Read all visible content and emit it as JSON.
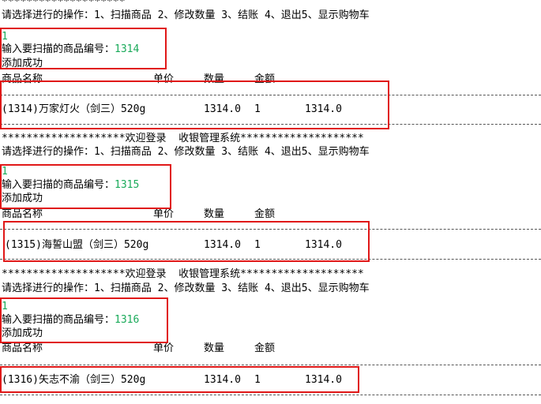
{
  "banner_full": "********************欢迎登录  收银管理系统********************",
  "banner_top": "********************",
  "menu": "请选择进行的操作：1、扫描商品 2、修改数量 3、结账 4、退出5、显示购物车",
  "input_choice": "1",
  "prompt": "输入要扫描的商品编号：",
  "success": "添加成功",
  "table_header": {
    "name": "商品名称",
    "price": "单价",
    "qty": "数量",
    "amount": "金额"
  },
  "blocks": [
    {
      "code": "1314",
      "row": {
        "name": "(1314)万家灯火（剑三）520g",
        "price": "1314.0",
        "qty": "1",
        "amount": "1314.0"
      }
    },
    {
      "code": "1315",
      "row": {
        "name": "(1315)海誓山盟（剑三）520g",
        "price": "1314.0",
        "qty": "1",
        "amount": "1314.0"
      }
    },
    {
      "code": "1316",
      "row": {
        "name": "(1316)矢志不渝（剑三）520g",
        "price": "1314.0",
        "qty": "1",
        "amount": "1314.0"
      }
    }
  ],
  "colors": {
    "input": "#1aaa5a",
    "highlight_box": "#e01818"
  }
}
